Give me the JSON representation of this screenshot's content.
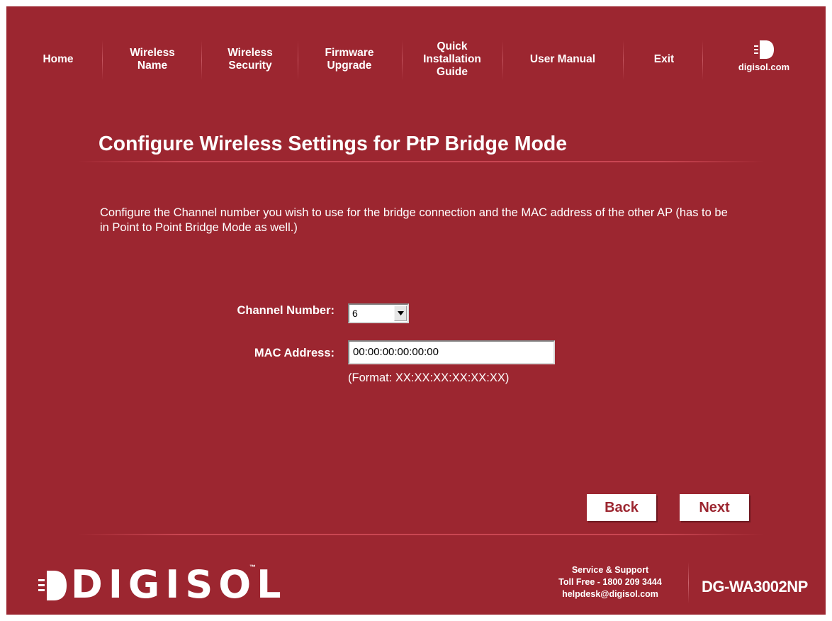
{
  "nav": {
    "items": [
      {
        "label": "Home"
      },
      {
        "label": "Wireless\nName"
      },
      {
        "label": "Wireless\nSecurity"
      },
      {
        "label": "Firmware\nUpgrade"
      },
      {
        "label": "Quick\nInstallation\nGuide"
      },
      {
        "label": "User Manual"
      },
      {
        "label": "Exit"
      }
    ],
    "logo_url": "digisol.com"
  },
  "page_title": "Configure Wireless Settings for PtP Bridge Mode",
  "description": "Configure the Channel number you wish to use for the bridge connection and the MAC address of the other AP (has to be in Point to Point Bridge Mode as well.)",
  "form": {
    "channel_label": "Channel Number:",
    "channel_value": "6",
    "mac_label": "MAC Address:",
    "mac_value": "00:00:00:00:00:00",
    "mac_format": "(Format: XX:XX:XX:XX:XX:XX)"
  },
  "buttons": {
    "back": "Back",
    "next": "Next"
  },
  "footer": {
    "brand": "DIGISOL",
    "trademark": "™",
    "support_title": "Service & Support",
    "toll_free": "Toll Free - 1800 209 3444",
    "email": "helpdesk@digisol.com",
    "model": "DG-WA3002NP"
  },
  "colors": {
    "background": "#9c2630",
    "text": "#ffffff",
    "button_text": "#9c2630"
  },
  "icons": {
    "logo": "digisol-d-logo-icon",
    "dropdown": "chevron-down-icon"
  }
}
